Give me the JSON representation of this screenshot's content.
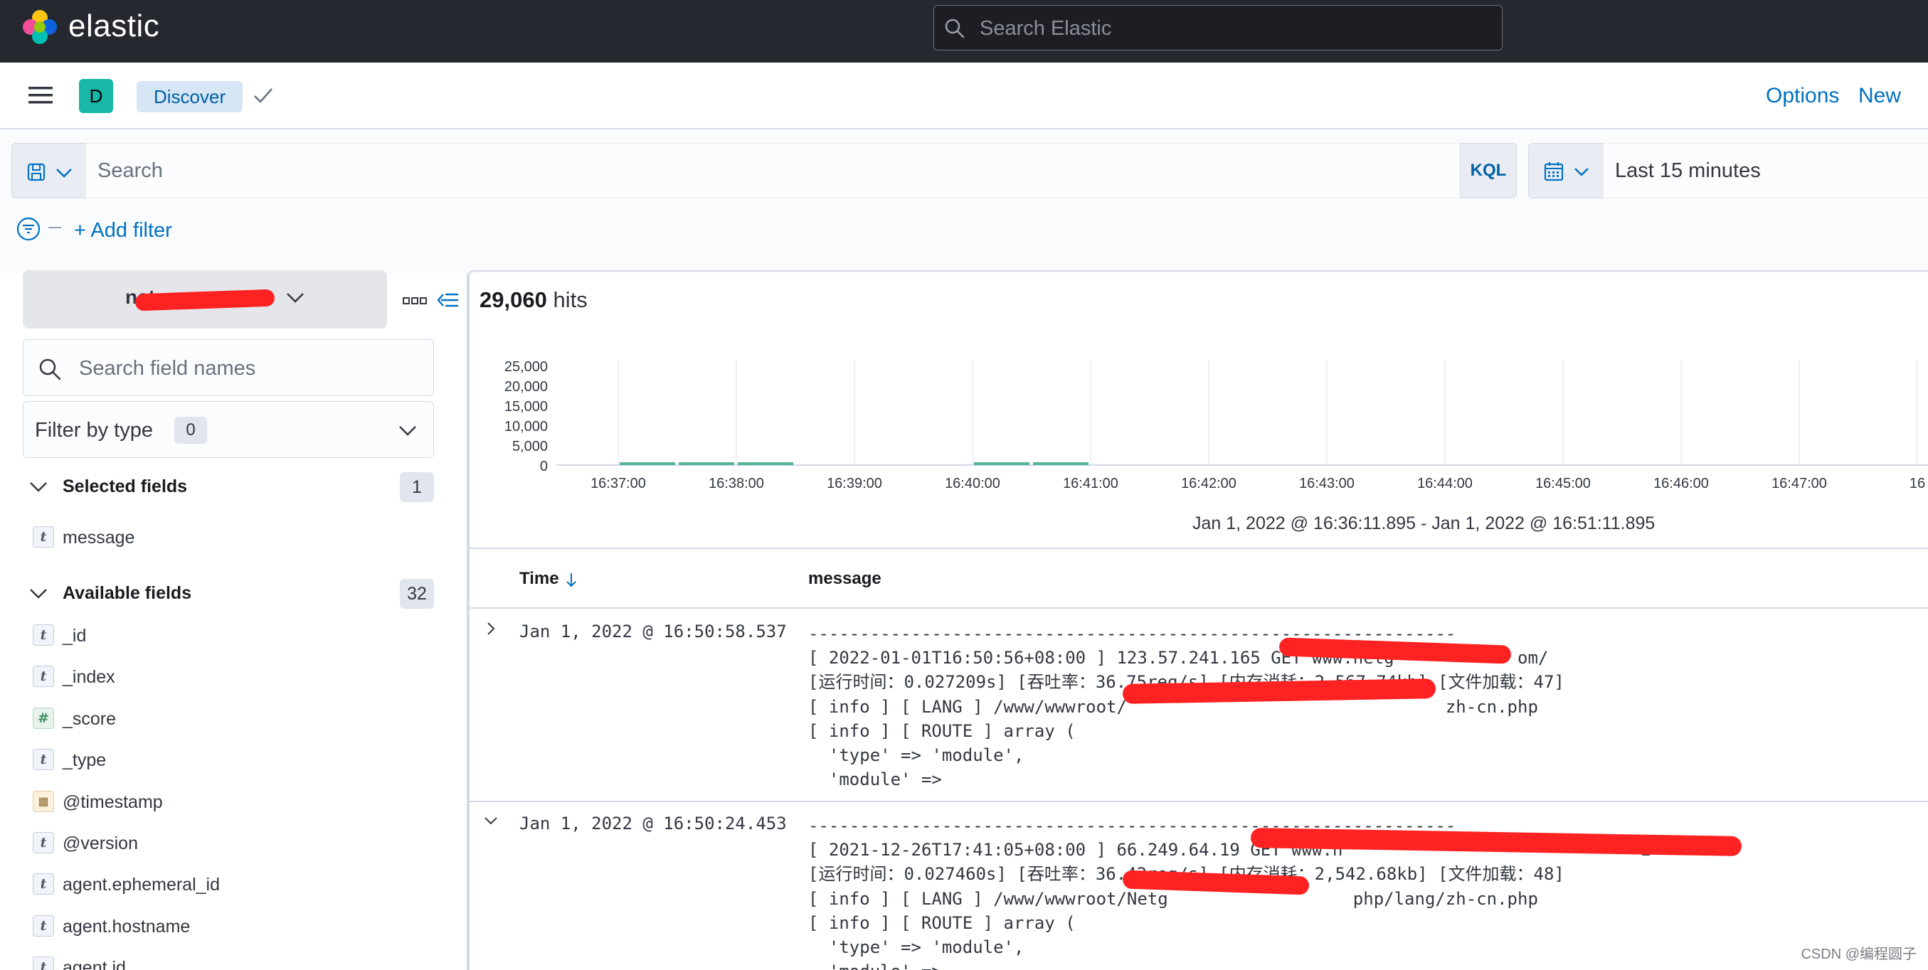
{
  "header": {
    "brand": "elastic",
    "search_placeholder": "Search Elastic"
  },
  "app_bar": {
    "space_initial": "D",
    "app_name": "Discover",
    "options_label": "Options",
    "new_label": "New"
  },
  "query_bar": {
    "search_placeholder": "Search",
    "language": "KQL",
    "time_range": "Last 15 minutes",
    "add_filter_label": "+ Add filter"
  },
  "sidebar": {
    "index_pattern_visible": "net",
    "field_search_placeholder": "Search field names",
    "filter_by_type": {
      "label": "Filter by type",
      "count": "0"
    },
    "selected": {
      "label": "Selected fields",
      "count": "1",
      "fields": [
        {
          "type": "t",
          "name": "message"
        }
      ]
    },
    "available": {
      "label": "Available fields",
      "count": "32",
      "fields": [
        {
          "type": "t",
          "name": "_id"
        },
        {
          "type": "t",
          "name": "_index"
        },
        {
          "type": "#",
          "name": "_score"
        },
        {
          "type": "t",
          "name": "_type"
        },
        {
          "type": "date",
          "name": "@timestamp"
        },
        {
          "type": "t",
          "name": "@version"
        },
        {
          "type": "t",
          "name": "agent.ephemeral_id"
        },
        {
          "type": "t",
          "name": "agent.hostname"
        },
        {
          "type": "t",
          "name": "agent.id"
        }
      ]
    }
  },
  "main": {
    "hits_count": "29,060",
    "hits_label": "hits",
    "range_text": "Jan 1, 2022 @ 16:36:11.895 - Jan 1, 2022 @ 16:51:11.895",
    "columns": {
      "time": "Time",
      "message": "message"
    },
    "rows": [
      {
        "time": "Jan 1, 2022 @ 16:50:58.537",
        "expanded": false,
        "message": "---------------------------------------------------------------\n[ 2022-01-01T16:50:56+08:00 ] 123.57.241.165 GET www.netg            om/\n[运行时间：0.027209s] [吞吐率：36.75req/s] [内存消耗：2,567.74kb] [文件加载：47]\n[ info ] [ LANG ] /www/wwwroot/                               zh-cn.php\n[ info ] [ ROUTE ] array (\n  'type' => 'module',\n  'module' =>"
      },
      {
        "time": "Jan 1, 2022 @ 16:50:24.453",
        "expanded": true,
        "message": "---------------------------------------------------------------\n[ 2021-12-26T17:41:05+08:00 ] 66.249.64.19 GET www.n                             2\n[运行时间：0.027460s] [吞吐率：36.42req/s] [内存消耗：2,542.68kb] [文件加载：48]\n[ info ] [ LANG ] /www/wwwroot/Netg                  php/lang/zh-cn.php\n[ info ] [ ROUTE ] array (\n  'type' => 'module',\n  'module' =>"
      }
    ]
  },
  "watermark": "CSDN @编程圆子",
  "colors": {
    "header_bg": "#25282f",
    "accent": "#0071c2",
    "bar": "#54b399",
    "redaction": "#ff2222"
  },
  "chart_data": {
    "type": "bar",
    "title": "",
    "xlabel": "",
    "ylabel": "",
    "ylim": [
      0,
      25000
    ],
    "yticks": [
      "25,000",
      "20,000",
      "15,000",
      "10,000",
      "5,000",
      "0"
    ],
    "categories": [
      "16:36:30",
      "16:37:00",
      "16:37:30",
      "16:38:00",
      "16:38:30",
      "16:39:00",
      "16:39:30",
      "16:40:00",
      "16:40:30",
      "16:41:00",
      "16:41:30",
      "16:42:00",
      "16:42:30",
      "16:43:00",
      "16:43:30",
      "16:44:00",
      "16:44:30",
      "16:45:00",
      "16:45:30",
      "16:46:00",
      "16:46:30",
      "16:47:00",
      "16:47:30"
    ],
    "xticks": [
      "16:37:00",
      "16:38:00",
      "16:39:00",
      "16:40:00",
      "16:41:00",
      "16:42:00",
      "16:43:00",
      "16:44:00",
      "16:45:00",
      "16:46:00",
      "16:47:00",
      "16"
    ],
    "series": [
      {
        "values": [
          0,
          500,
          500,
          500,
          0,
          0,
          0,
          500,
          500,
          0,
          0,
          0,
          0,
          0,
          0,
          0,
          0,
          0,
          0,
          0,
          0,
          0,
          0
        ]
      }
    ],
    "grid": true
  }
}
